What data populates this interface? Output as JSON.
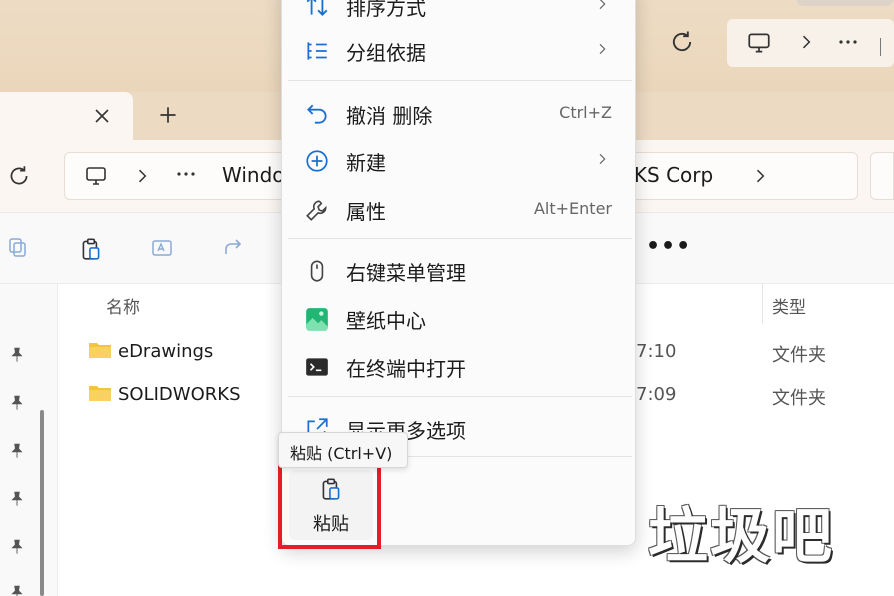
{
  "address_bar": {
    "crumb_windows": "Windo",
    "crumb_corp": "RKS Corp"
  },
  "file_list": {
    "col_name": "名称",
    "col_type": "类型",
    "rows": [
      {
        "name": "eDrawings",
        "date": "7:10",
        "type": "文件夹"
      },
      {
        "name": "SOLIDWORKS",
        "date": "7:09",
        "type": "文件夹"
      }
    ]
  },
  "context_menu": {
    "sort": "排序方式",
    "group": "分组依据",
    "undo": "撤消 删除",
    "undo_shortcut": "Ctrl+Z",
    "new": "新建",
    "properties": "属性",
    "properties_shortcut": "Alt+Enter",
    "right_click_mgr": "右键菜单管理",
    "wallpaper": "壁纸中心",
    "terminal": "在终端中打开",
    "more_options": "显示更多选项",
    "tooltip": "粘贴 (Ctrl+V)",
    "paste": "粘贴"
  },
  "overlay": {
    "stamp": "垃圾吧"
  },
  "icons": {
    "menu": [
      "sort-icon",
      "group-icon",
      "undo-icon",
      "new-icon",
      "wrench-icon",
      "mouse-icon",
      "wallpaper-icon",
      "terminal-icon",
      "more-options-icon",
      "paste-icon"
    ],
    "toolbar": [
      "copy-icon",
      "paste-icon",
      "rename-icon",
      "share-icon"
    ]
  },
  "colors": {
    "highlight": "#e41e25",
    "wallpaper_icon": "#22b573",
    "folder": "#f5c342",
    "accent_blue": "#1a6fd1"
  }
}
